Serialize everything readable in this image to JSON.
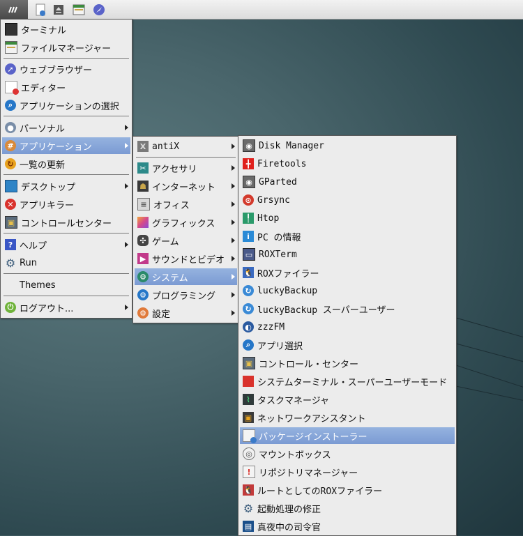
{
  "taskbar": {
    "start_icon": "antix-start-icon",
    "launchers": [
      "file-manager-icon",
      "eject-icon",
      "folder-icon",
      "browser-icon"
    ]
  },
  "main_menu": {
    "items": [
      {
        "label": "ターミナル",
        "icon": "terminal-icon"
      },
      {
        "label": "ファイルマネージャー",
        "icon": "file-manager-icon"
      },
      {
        "label": "ウェブブラウザー",
        "icon": "browser-icon"
      },
      {
        "label": "エディター",
        "icon": "editor-icon"
      },
      {
        "label": "アプリケーションの選択",
        "icon": "app-select-icon"
      },
      {
        "label": "パーソナル",
        "icon": "personal-icon"
      },
      {
        "label": "アプリケーション",
        "icon": "applications-icon"
      },
      {
        "label": "一覧の更新",
        "icon": "refresh-icon"
      },
      {
        "label": "デスクトップ",
        "icon": "desktop-icon"
      },
      {
        "label": "アプリキラー",
        "icon": "app-killer-icon"
      },
      {
        "label": "コントロールセンター",
        "icon": "control-center-icon"
      },
      {
        "label": "ヘルプ",
        "icon": "help-icon"
      },
      {
        "label": "Run",
        "icon": "gear-icon"
      },
      {
        "label": "Themes",
        "icon": ""
      },
      {
        "label": "ログアウト...",
        "icon": "logout-icon"
      }
    ]
  },
  "app_menu": {
    "items": [
      {
        "label": "antiX",
        "icon": "antix-icon"
      },
      {
        "label": "アクセサリ",
        "icon": "accessories-icon"
      },
      {
        "label": "インターネット",
        "icon": "internet-icon"
      },
      {
        "label": "オフィス",
        "icon": "office-icon"
      },
      {
        "label": "グラフィックス",
        "icon": "graphics-icon"
      },
      {
        "label": "ゲーム",
        "icon": "game-icon"
      },
      {
        "label": "サウンドとビデオ",
        "icon": "multimedia-icon"
      },
      {
        "label": "システム",
        "icon": "system-icon"
      },
      {
        "label": "プログラミング",
        "icon": "programming-icon"
      },
      {
        "label": "設定",
        "icon": "settings-icon"
      }
    ]
  },
  "system_menu": {
    "items": [
      {
        "label": "Disk Manager",
        "icon": "disk-manager-icon"
      },
      {
        "label": "Firetools",
        "icon": "firetools-icon"
      },
      {
        "label": "GParted",
        "icon": "gparted-icon"
      },
      {
        "label": "Grsync",
        "icon": "grsync-icon"
      },
      {
        "label": "Htop",
        "icon": "htop-icon"
      },
      {
        "label": "PC の情報",
        "icon": "info-icon"
      },
      {
        "label": "ROXTerm",
        "icon": "roxterm-icon"
      },
      {
        "label": "ROXファイラー",
        "icon": "rox-filer-icon"
      },
      {
        "label": "luckyBackup",
        "icon": "luckybackup-icon"
      },
      {
        "label": "luckyBackup スーパーユーザー",
        "icon": "luckybackup-icon"
      },
      {
        "label": "zzzFM",
        "icon": "zzzfm-icon"
      },
      {
        "label": "アプリ選択",
        "icon": "app-select-icon"
      },
      {
        "label": "コントロール・センター",
        "icon": "control-center-icon"
      },
      {
        "label": "システムターミナル・スーパーユーザーモード",
        "icon": "root-terminal-icon"
      },
      {
        "label": "タスクマネージャ",
        "icon": "task-manager-icon"
      },
      {
        "label": "ネットワークアシスタント",
        "icon": "network-assistant-icon"
      },
      {
        "label": "パッケージインストーラー",
        "icon": "package-installer-icon"
      },
      {
        "label": "マウントボックス",
        "icon": "mountbox-icon"
      },
      {
        "label": "リポジトリマネージャー",
        "icon": "repo-manager-icon"
      },
      {
        "label": "ルートとしてのROXファイラー",
        "icon": "rox-filer-root-icon"
      },
      {
        "label": "起動処理の修正",
        "icon": "startup-icon"
      },
      {
        "label": "真夜中の司令官",
        "icon": "midnight-commander-icon"
      }
    ]
  }
}
